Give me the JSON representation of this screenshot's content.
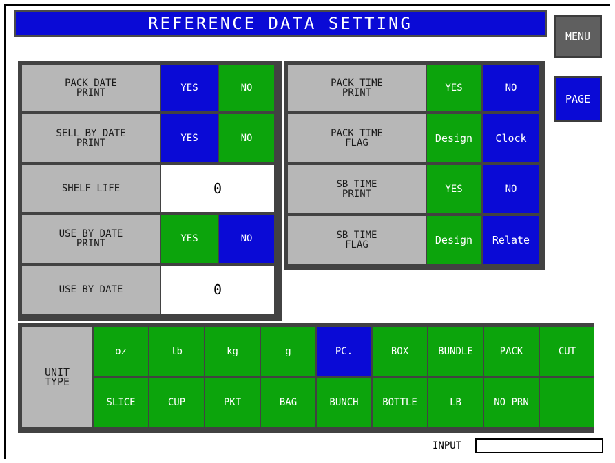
{
  "title": "REFERENCE DATA SETTING",
  "side": {
    "menu": "MENU",
    "page": "PAGE"
  },
  "left": {
    "pack_date_print": {
      "label": "PACK DATE\nPRINT",
      "yes": "YES",
      "no": "NO"
    },
    "sell_by_date_print": {
      "label": "SELL BY DATE\nPRINT",
      "yes": "YES",
      "no": "NO"
    },
    "shelf_life": {
      "label": "SHELF LIFE",
      "value": "0"
    },
    "use_by_date_print": {
      "label": "USE BY DATE\nPRINT",
      "yes": "YES",
      "no": "NO"
    },
    "use_by_date": {
      "label": "USE BY DATE",
      "value": "0"
    }
  },
  "right": {
    "pack_time_print": {
      "label": "PACK TIME\nPRINT",
      "yes": "YES",
      "no": "NO"
    },
    "pack_time_flag": {
      "label": "PACK TIME\nFLAG",
      "opt1": "Design",
      "opt2": "Clock"
    },
    "sb_time_print": {
      "label": "SB TIME\nPRINT",
      "yes": "YES",
      "no": "NO"
    },
    "sb_time_flag": {
      "label": "SB TIME\nFLAG",
      "opt1": "Design",
      "opt2": "Relate"
    }
  },
  "unit_type": {
    "label": "UNIT\nTYPE",
    "row1": [
      "oz",
      "lb",
      "kg",
      "g",
      "PC.",
      "BOX",
      "BUNDLE",
      "PACK",
      "CUT"
    ],
    "row2": [
      "SLICE",
      "CUP",
      "PKT",
      "BAG",
      "BUNCH",
      "BOTTLE",
      "LB",
      "NO PRN",
      ""
    ],
    "selected": "PC."
  },
  "input": {
    "label": "INPUT",
    "value": ""
  }
}
